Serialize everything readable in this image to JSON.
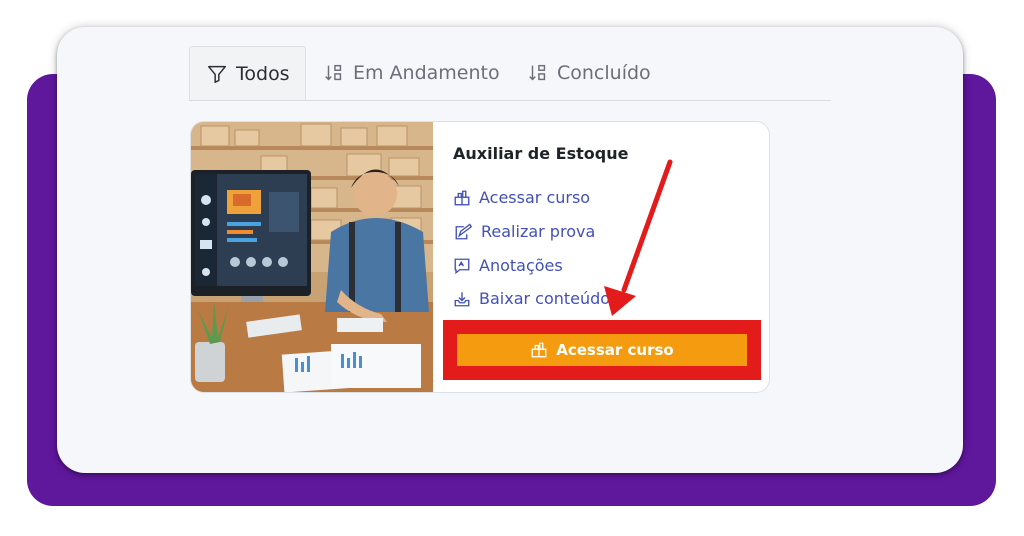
{
  "tabs": [
    {
      "label": "Todos",
      "icon": "filter-icon",
      "active": true
    },
    {
      "label": "Em Andamento",
      "icon": "sort-icon",
      "active": false
    },
    {
      "label": "Concluído",
      "icon": "sort-icon",
      "active": false
    }
  ],
  "course": {
    "title": "Auxiliar de Estoque",
    "actions": [
      {
        "label": "Acessar curso",
        "icon": "course-box-icon"
      },
      {
        "label": "Realizar prova",
        "icon": "exam-pen-icon"
      },
      {
        "label": "Anotações",
        "icon": "notes-icon"
      },
      {
        "label": "Baixar conteúdo",
        "icon": "download-icon"
      }
    ],
    "primary_button": {
      "label": "Acessar curso",
      "icon": "course-box-icon"
    }
  },
  "colors": {
    "frame_purple": "#5f179c",
    "link_blue": "#4350b8",
    "button_orange": "#f59b0f",
    "highlight_red": "#e31b1b"
  }
}
